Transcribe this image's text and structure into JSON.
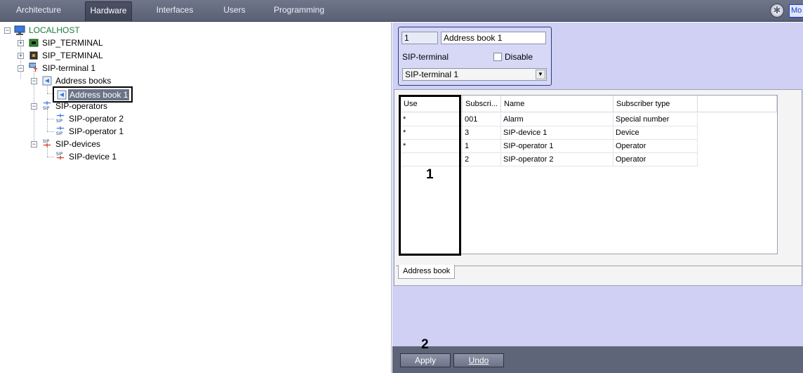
{
  "topbar": {
    "tabs": [
      {
        "label": "Architecture"
      },
      {
        "label": "Hardware"
      },
      {
        "label": "Interfaces"
      },
      {
        "label": "Users"
      },
      {
        "label": "Programming"
      }
    ],
    "active_tab": "Hardware",
    "mo_label": "Mo"
  },
  "tree": {
    "root": "LOCALHOST",
    "sip_terminal_a": "SIP_TERMINAL",
    "sip_terminal_b": "SIP_TERMINAL",
    "sip_terminal_1": "SIP-terminal 1",
    "address_books": "Address books",
    "address_book_1": "Address book 1",
    "sip_operators": "SIP-operators",
    "sip_operator_2": "SIP-operator 2",
    "sip_operator_1": "SIP-operator 1",
    "sip_devices": "SIP-devices",
    "sip_device_1": "SIP-device 1"
  },
  "settings": {
    "id_value": "1",
    "name_value": "Address book 1",
    "sip_terminal_label": "SIP-terminal",
    "disable_label": "Disable",
    "sip_terminal_value": "SIP-terminal 1"
  },
  "grid": {
    "headers": [
      "Use",
      "Subscri...",
      "Name",
      "Subscriber type"
    ],
    "rows": [
      {
        "use": "*",
        "subscriber": "001",
        "name": "Alarm",
        "type": "Special number"
      },
      {
        "use": "*",
        "subscriber": "3",
        "name": "SIP-device 1",
        "type": "Device"
      },
      {
        "use": "*",
        "subscriber": "1",
        "name": "SIP-operator 1",
        "type": "Operator"
      },
      {
        "use": "",
        "subscriber": "2",
        "name": "SIP-operator 2",
        "type": "Operator"
      }
    ]
  },
  "tab_label": "Address book",
  "buttons": {
    "apply": "Apply",
    "undo": "Undo"
  },
  "annotations": {
    "one": "1",
    "two": "2"
  },
  "colors": {
    "accent_tree_root": "#1a7a3a",
    "selection": "#6b7488",
    "panel_bg": "#cfd0f4"
  }
}
